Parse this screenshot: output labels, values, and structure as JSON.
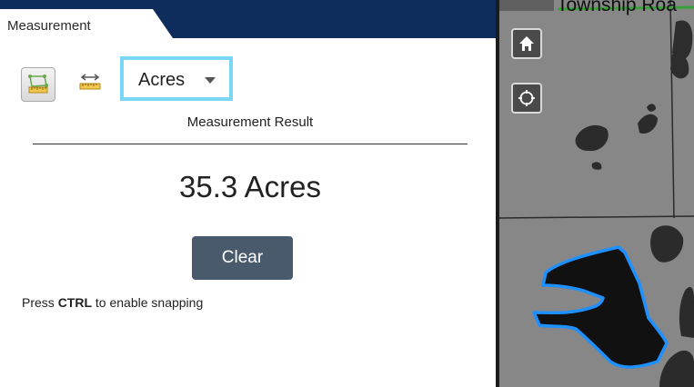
{
  "panel": {
    "tab_label": "Measurement",
    "tools": [
      {
        "icon": "area-ruler-icon",
        "active": true
      },
      {
        "icon": "distance-ruler-icon",
        "active": false
      }
    ],
    "units": {
      "selected": "Acres"
    },
    "result_heading": "Measurement Result",
    "result_value": "35.3 Acres",
    "clear_label": "Clear",
    "hint": {
      "prefix": "Press ",
      "key": "CTRL",
      "suffix": " to enable snapping"
    }
  },
  "map": {
    "road_label": "Township Roa",
    "buttons": [
      {
        "icon": "home-icon"
      },
      {
        "icon": "locate-icon"
      }
    ],
    "measurement_color": "#1e90ff"
  },
  "colors": {
    "header": "#0f2d5c",
    "select_highlight": "#7ad6f5",
    "clear_button": "#4a5a6d"
  }
}
